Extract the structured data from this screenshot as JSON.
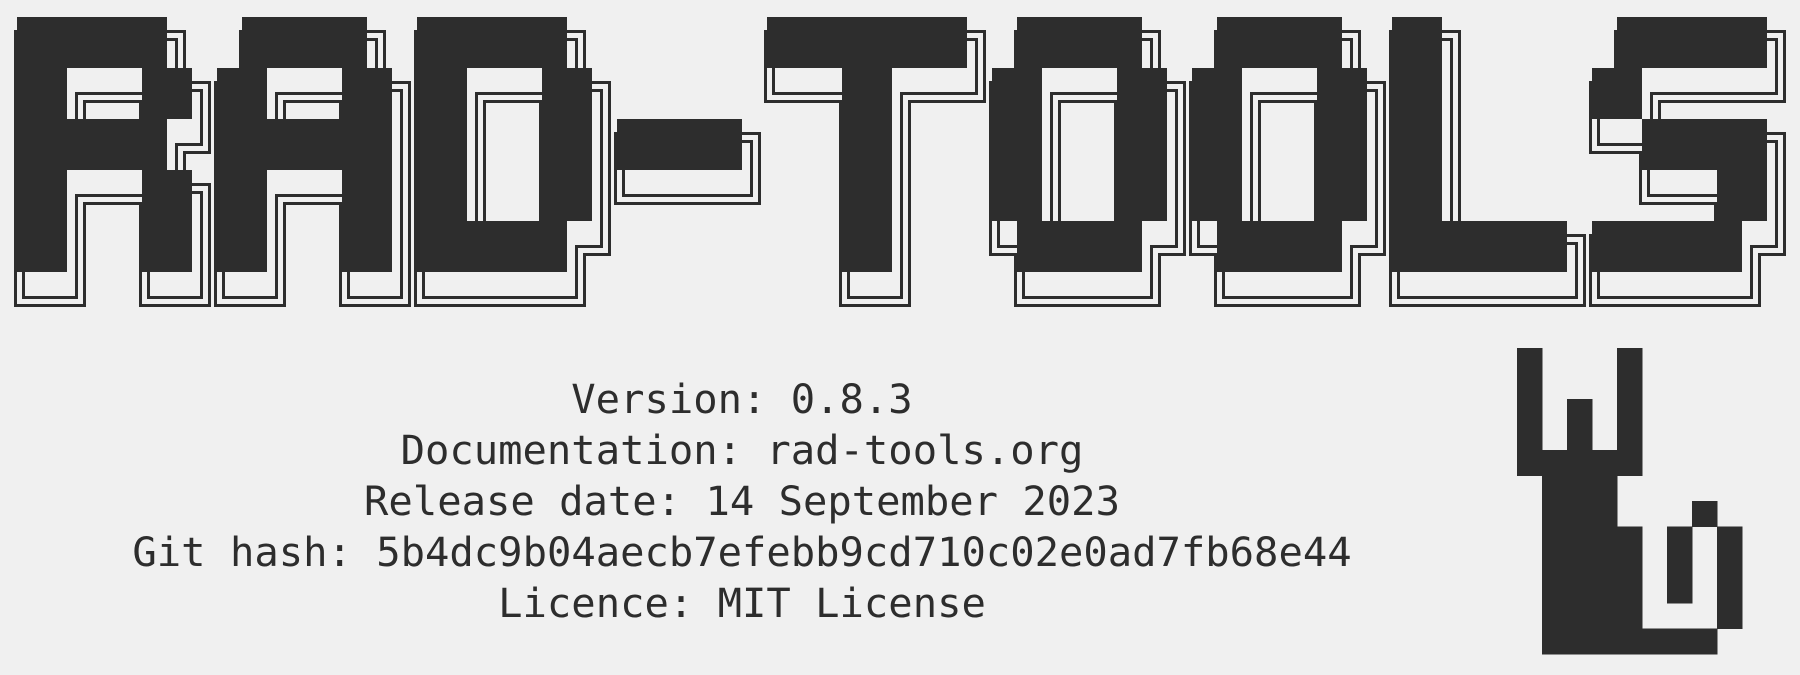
{
  "logo": {
    "text": "RAD-TOOLS"
  },
  "info": [
    {
      "label": "Version",
      "value": "0.8.3"
    },
    {
      "label": "Documentation",
      "value": "rad-tools.org"
    },
    {
      "label": "Release date",
      "value": "14 September 2023"
    },
    {
      "label": "Git hash",
      "value": "5b4dc9b04aecb7efebb9cd710c02e0ad7fb68e44"
    },
    {
      "label": "Licence",
      "value": "MIT License"
    }
  ],
  "mascot": {
    "icon": "pixel-cat-icon"
  },
  "colors": {
    "foreground": "#2d2d2d",
    "background": "#f0f0f0"
  }
}
